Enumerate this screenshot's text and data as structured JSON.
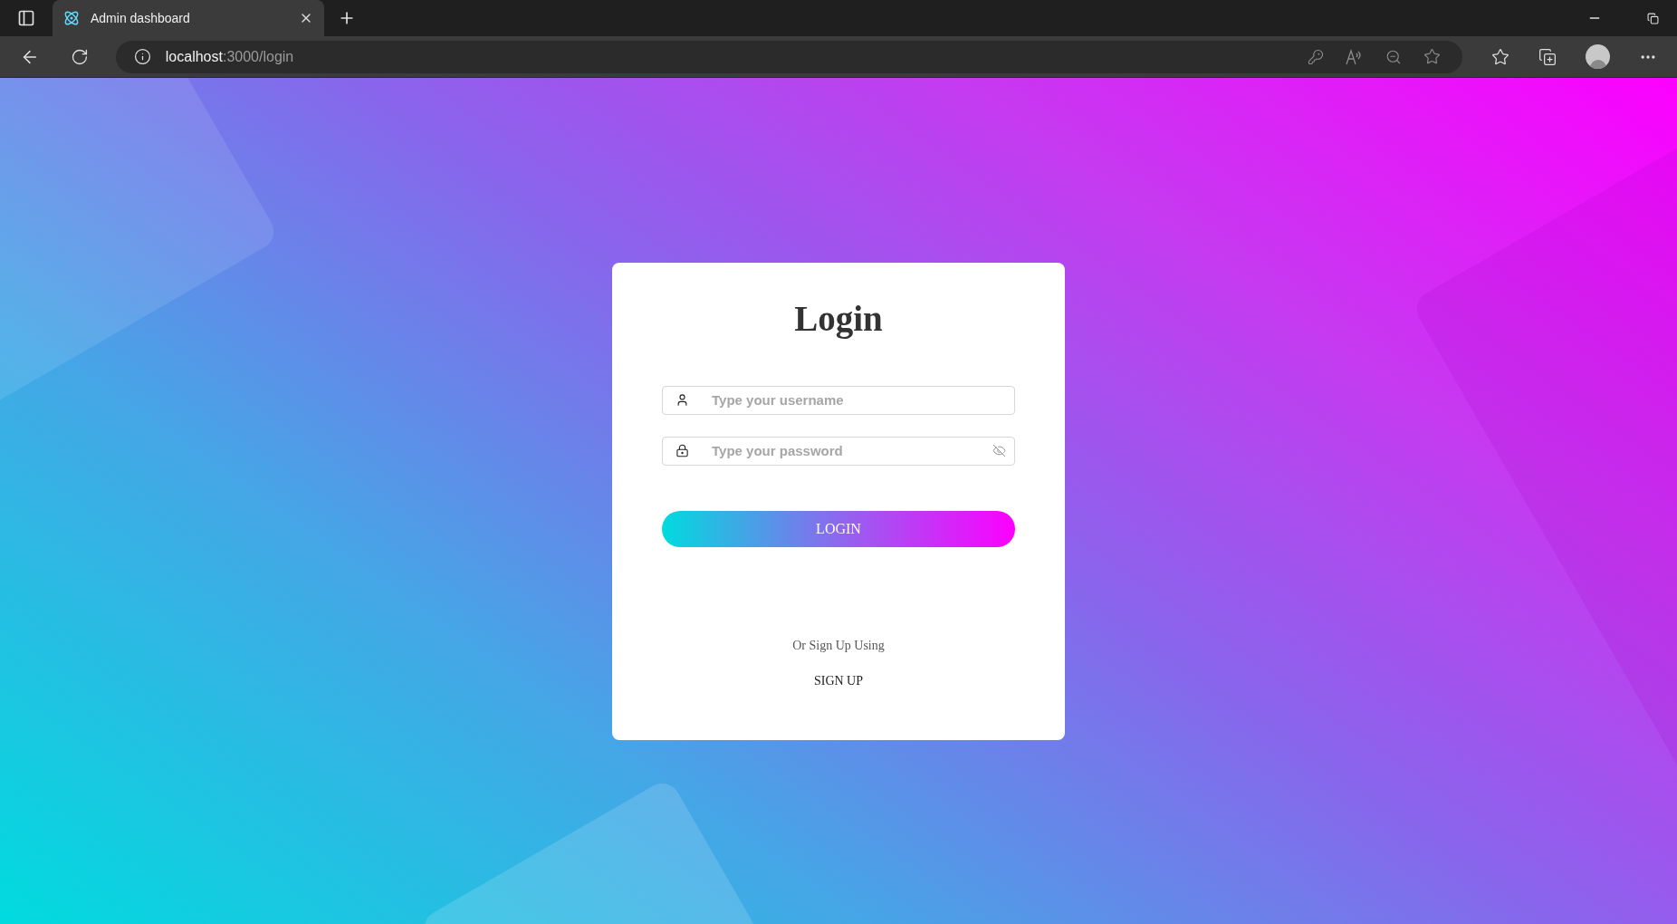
{
  "browser": {
    "tab": {
      "title": "Admin dashboard"
    },
    "address": {
      "host": "localhost",
      "path": ":3000/login"
    }
  },
  "login": {
    "title": "Login",
    "fields": [
      {
        "kind": "username",
        "placeholder": "Type your username"
      },
      {
        "kind": "password",
        "placeholder": "Type your password"
      }
    ],
    "button": "LOGIN",
    "signup_hint": "Or Sign Up Using",
    "signup_link": "SIGN UP"
  }
}
